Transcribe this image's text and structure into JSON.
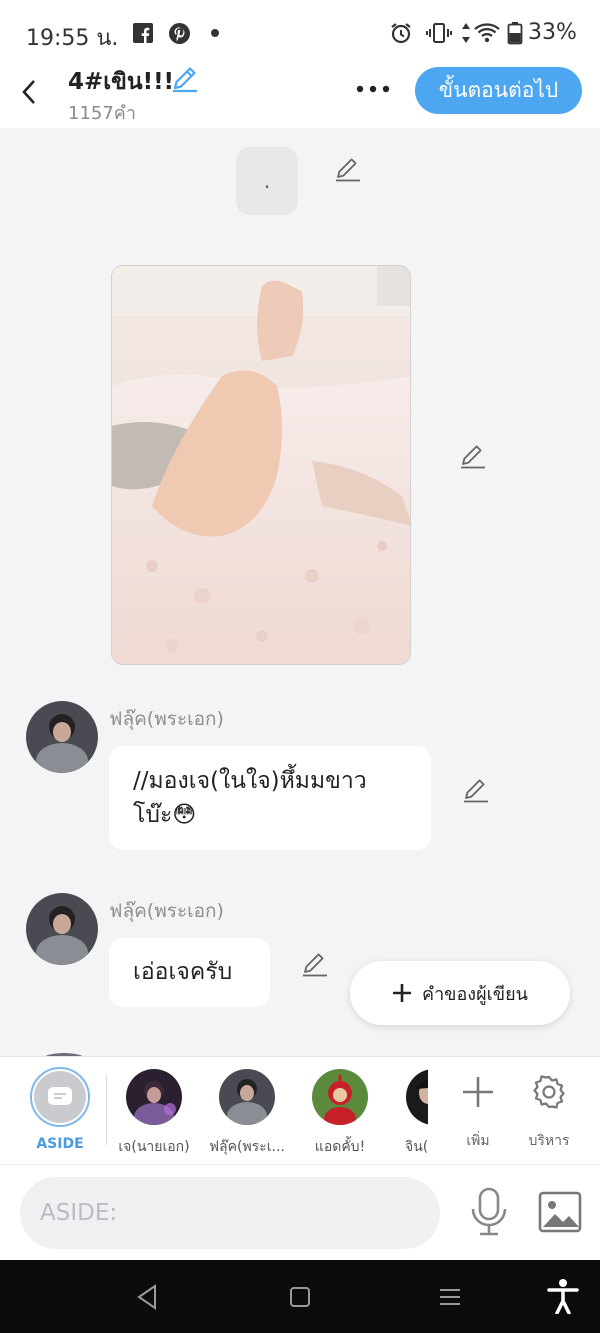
{
  "status_bar": {
    "time": "19:55 น.",
    "battery_percent": "33%",
    "icons": [
      "facebook-icon",
      "pinterest-icon",
      "notification-dot-icon",
      "alarm-icon",
      "vibrate-icon",
      "data-arrows-icon",
      "wifi-icon",
      "battery-icon"
    ]
  },
  "header": {
    "title": "4#เขิน!!!",
    "word_count": "1157คำ",
    "next_button": "ขั้นตอนต่อไป"
  },
  "content": {
    "dot_message": ".",
    "messages": [
      {
        "speaker": "ฟลุ๊ค(พระเอก)",
        "text": "//มองเจ(ในใจ)หึ้มมขาว\nโบ๊ะ😳"
      },
      {
        "speaker": "ฟลุ๊ค(พระเอก)",
        "text": "เอ่อเจครับ"
      }
    ],
    "author_button": "คำของผู้เขียน"
  },
  "character_bar": {
    "aside_label": "ASIDE",
    "characters": [
      {
        "label": "เจ(นายเอก)"
      },
      {
        "label": "ฟลุ๊ค(พระเ..."
      },
      {
        "label": "แอดคั้บ!"
      },
      {
        "label": "จิน("
      }
    ],
    "add_label": "เพิ่ม",
    "manage_label": "บริหาร"
  },
  "input": {
    "placeholder": "ASIDE:"
  },
  "colors": {
    "accent": "#4da6f0",
    "background": "#f3f4f6",
    "nav_bar": "#0b0b0b"
  }
}
